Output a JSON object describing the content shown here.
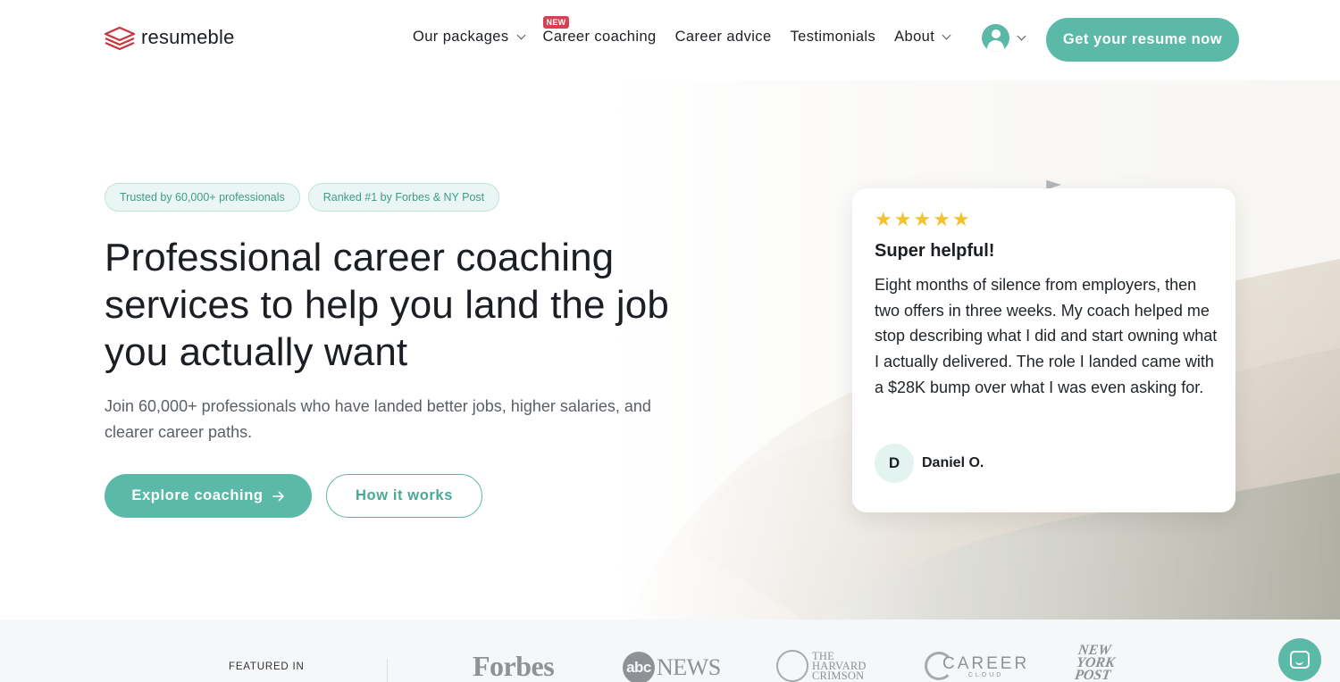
{
  "brand": {
    "name": "resumeble",
    "accent": "#5bbaa7",
    "badge_red": "#d94152"
  },
  "nav": {
    "items": [
      {
        "label": "Our packages",
        "has_dropdown": true
      },
      {
        "label": "Career coaching",
        "badge": "NEW"
      },
      {
        "label": "Career advice"
      },
      {
        "label": "Testimonials"
      },
      {
        "label": "About",
        "has_dropdown": true
      }
    ],
    "account_icon": "user-icon",
    "cta": "Get your resume now"
  },
  "hero": {
    "pills": [
      "Trusted by 60,000+ professionals",
      "Ranked #1 by Forbes & NY Post"
    ],
    "title": "Professional career coaching services to help you land the job you actually want",
    "subtitle": "Join 60,000+ professionals who have landed better jobs, higher salaries, and clearer career paths.",
    "primary_button": "Explore coaching",
    "secondary_button": "How it works"
  },
  "review": {
    "rating": 5,
    "title": "Super helpful!",
    "text": "Eight months of silence from employers, then two offers in three weeks. My coach helped me stop describing what I did and start owning what I actually delivered. The role I landed came with a $28K bump over what I was even asking for.",
    "initial": "D",
    "name": "Daniel O."
  },
  "featured": {
    "label": "FEATURED IN",
    "logos": {
      "forbes": "Forbes",
      "abc_circle": "abc",
      "abc_news": "NEWS",
      "harvard_line1": "THE",
      "harvard_line2": "HARVARD",
      "harvard_line3": "CRIMSON",
      "careercloud_main": "CAREER",
      "careercloud_sub": "CLOUD",
      "nypost_line1": "NEW",
      "nypost_line2": "YORK",
      "nypost_line3": "POST"
    }
  },
  "chat_icon": "chat-icon"
}
